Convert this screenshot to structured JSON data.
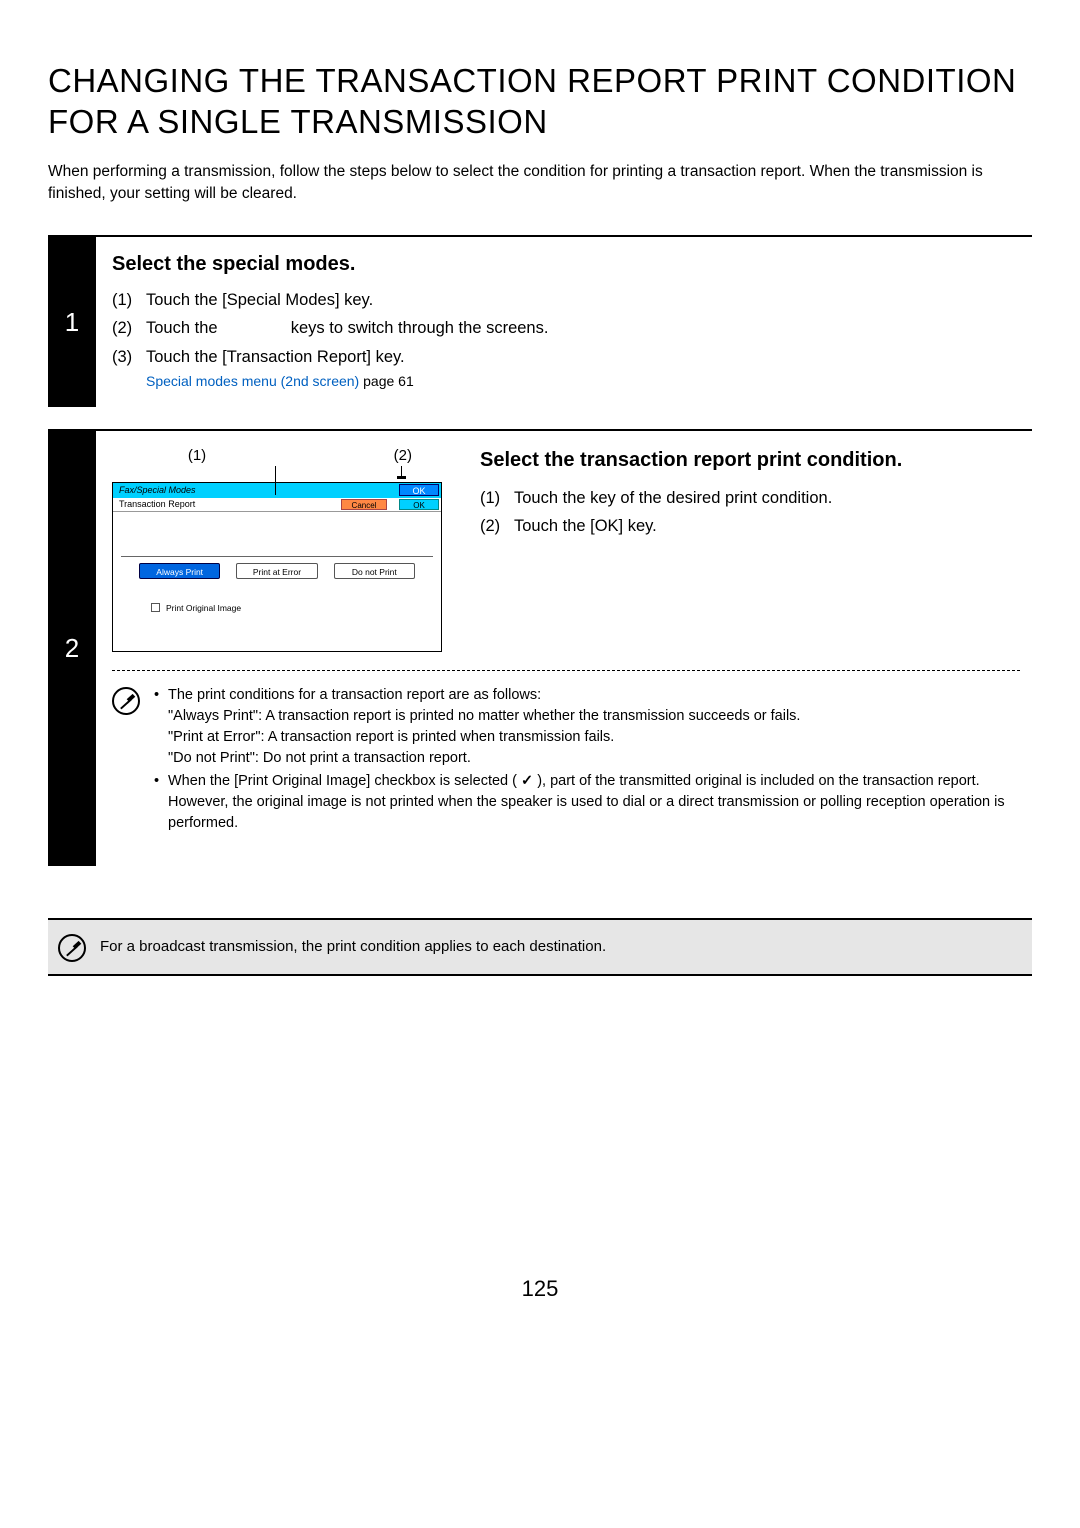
{
  "title": "CHANGING THE TRANSACTION REPORT PRINT CONDITION FOR A SINGLE TRANSMISSION",
  "intro": "When performing a transmission, follow the steps below to select the condition for printing a transaction report. When the transmission is finished, your setting will be cleared.",
  "step1": {
    "num": "1",
    "heading": "Select the special modes.",
    "items": {
      "n1": "(1)",
      "t1": "Touch the [Special Modes] key.",
      "n2": "(2)",
      "t2a": "Touch the ",
      "t2b": " keys to switch through the screens.",
      "n3": "(3)",
      "t3": "Touch the [Transaction Report] key."
    },
    "link": "Special modes menu (2nd screen)",
    "link_page": " page 61"
  },
  "step2": {
    "num": "2",
    "callout1": "(1)",
    "callout2": "(2)",
    "ui": {
      "top_left": "Fax/Special Modes",
      "top_ok": "OK",
      "row2_left": "Transaction Report",
      "cancel": "Cancel",
      "ok2": "OK",
      "b1": "Always Print",
      "b2": "Print at Error",
      "b3": "Do not Print",
      "print_orig": "Print Original Image"
    },
    "right_heading": "Select the transaction report print condition.",
    "right_items": {
      "n1": "(1)",
      "t1": "Touch the key of the desired print condition.",
      "n2": "(2)",
      "t2": "Touch the [OK] key."
    },
    "notes": {
      "intro": "The print conditions for a transaction report are as follows:",
      "l1": "\"Always Print\":  A transaction report is printed no matter whether the transmission succeeds or fails.",
      "l2": "\"Print at Error\": A transaction report is printed when transmission fails.",
      "l3": "\"Do not Print\":  Do not print a transaction report.",
      "b2a": "When the [Print Original Image] checkbox is selected (",
      "b2b": "), part of the transmitted original is included on the transaction report. However, the original image is not printed when the speaker is used to dial or a direct transmission or polling reception operation is performed."
    }
  },
  "footer": "For a broadcast transmission, the print condition applies to each destination.",
  "page_number": "125"
}
